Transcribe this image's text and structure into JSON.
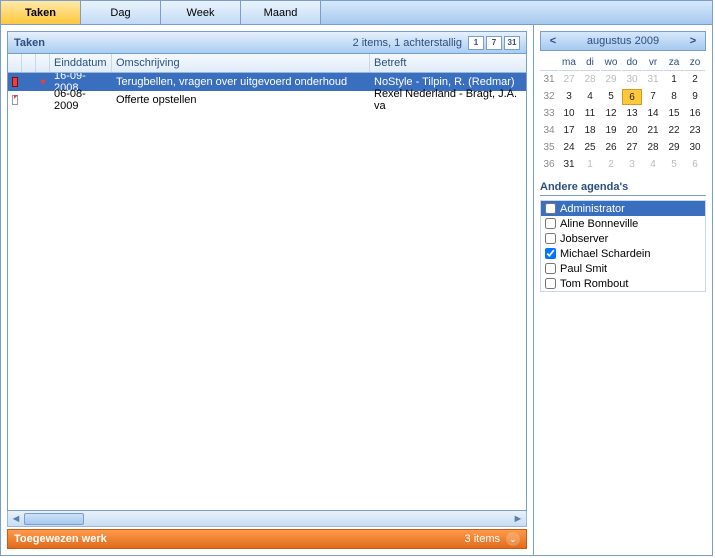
{
  "tabs": {
    "items": [
      "Taken",
      "Dag",
      "Week",
      "Maand"
    ],
    "active": 0
  },
  "panel": {
    "title": "Taken",
    "summary": "2 items, 1 achterstallig",
    "tools": [
      "1",
      "7",
      "31"
    ],
    "columns": {
      "date": "Einddatum",
      "desc": "Omschrijving",
      "betreft": "Betreft"
    },
    "rows": [
      {
        "date": "16-09-2008",
        "desc": "Terugbellen, vragen over uitgevoerd onderhoud",
        "betreft": "NoStyle - Tilpin, R.  (Redmar)",
        "selected": true,
        "flag": true,
        "task": true
      },
      {
        "date": "06-08-2009",
        "desc": "Offerte opstellen",
        "betreft": "Rexel Nederland - Bragt, J.A. va",
        "selected": false,
        "flag": false,
        "task": false
      }
    ]
  },
  "footer": {
    "title": "Toegewezen werk",
    "count": "3 items"
  },
  "calendar": {
    "title": "augustus 2009",
    "prev": "<",
    "next": ">",
    "dow": [
      "ma",
      "di",
      "wo",
      "do",
      "vr",
      "za",
      "zo"
    ],
    "weeks": [
      {
        "wk": "31",
        "days": [
          {
            "d": "27",
            "o": true
          },
          {
            "d": "28",
            "o": true
          },
          {
            "d": "29",
            "o": true
          },
          {
            "d": "30",
            "o": true
          },
          {
            "d": "31",
            "o": true
          },
          {
            "d": "1"
          },
          {
            "d": "2"
          }
        ]
      },
      {
        "wk": "32",
        "days": [
          {
            "d": "3"
          },
          {
            "d": "4"
          },
          {
            "d": "5"
          },
          {
            "d": "6",
            "t": true
          },
          {
            "d": "7"
          },
          {
            "d": "8"
          },
          {
            "d": "9"
          }
        ]
      },
      {
        "wk": "33",
        "days": [
          {
            "d": "10"
          },
          {
            "d": "11"
          },
          {
            "d": "12"
          },
          {
            "d": "13"
          },
          {
            "d": "14"
          },
          {
            "d": "15"
          },
          {
            "d": "16"
          }
        ]
      },
      {
        "wk": "34",
        "days": [
          {
            "d": "17"
          },
          {
            "d": "18"
          },
          {
            "d": "19"
          },
          {
            "d": "20"
          },
          {
            "d": "21"
          },
          {
            "d": "22"
          },
          {
            "d": "23"
          }
        ]
      },
      {
        "wk": "35",
        "days": [
          {
            "d": "24"
          },
          {
            "d": "25"
          },
          {
            "d": "26"
          },
          {
            "d": "27"
          },
          {
            "d": "28"
          },
          {
            "d": "29"
          },
          {
            "d": "30"
          }
        ]
      },
      {
        "wk": "36",
        "days": [
          {
            "d": "31"
          },
          {
            "d": "1",
            "o": true
          },
          {
            "d": "2",
            "o": true
          },
          {
            "d": "3",
            "o": true
          },
          {
            "d": "4",
            "o": true
          },
          {
            "d": "5",
            "o": true
          },
          {
            "d": "6",
            "o": true
          }
        ]
      }
    ]
  },
  "agendas": {
    "title": "Andere agenda's",
    "items": [
      {
        "label": "Administrator",
        "checked": false,
        "sel": true
      },
      {
        "label": "Aline Bonneville",
        "checked": false
      },
      {
        "label": "Jobserver",
        "checked": false
      },
      {
        "label": "Michael Schardein",
        "checked": true
      },
      {
        "label": "Paul Smit",
        "checked": false
      },
      {
        "label": "Tom Rombout",
        "checked": false
      }
    ]
  }
}
